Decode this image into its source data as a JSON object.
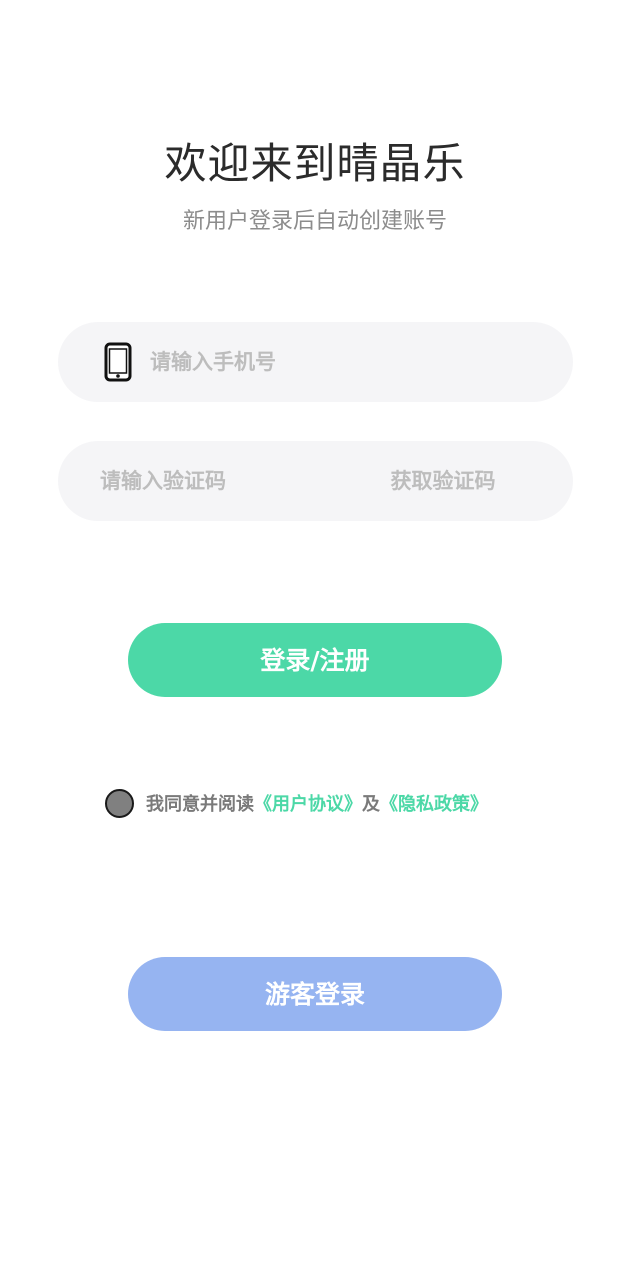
{
  "header": {
    "title": "欢迎来到晴晶乐",
    "subtitle": "新用户登录后自动创建账号"
  },
  "form": {
    "phone_placeholder": "请输入手机号",
    "phone_icon": "smartphone-icon",
    "code_placeholder": "请输入验证码",
    "get_code_label": "获取验证码"
  },
  "buttons": {
    "login_label": "登录/注册",
    "guest_label": "游客登录"
  },
  "agreement": {
    "checked": false,
    "prefix": "我同意并阅读",
    "user_agreement": "《用户协议》",
    "connector": "及",
    "privacy_policy": "《隐私政策》"
  },
  "colors": {
    "accent": "#4cd8a7",
    "guest_button": "#96b4f1",
    "field_background": "#f5f5f7",
    "placeholder": "#bdbdbd",
    "title": "#2b2b2b",
    "subtitle": "#8c8c8c"
  }
}
